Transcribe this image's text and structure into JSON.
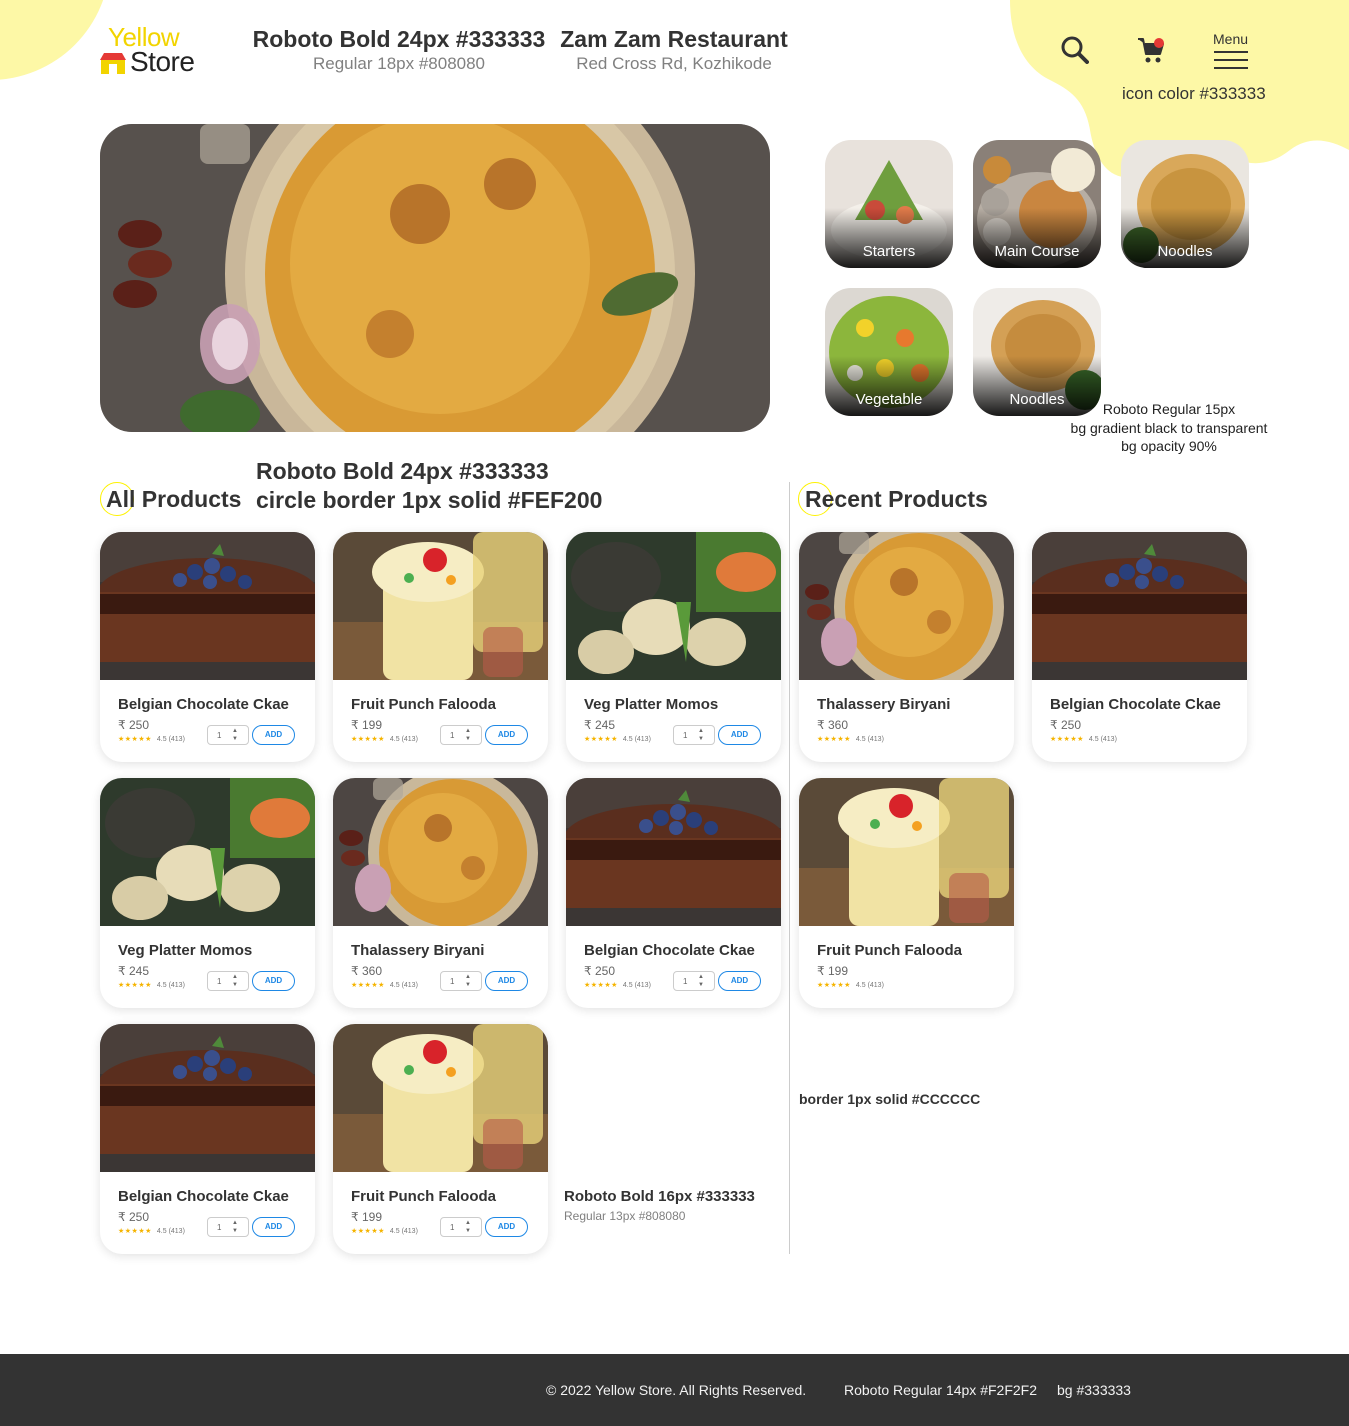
{
  "brand": {
    "logo_word1": "Yellow",
    "logo_word2": "Store",
    "accent_color": "#FEF200",
    "blob_color": "#FDF8A6"
  },
  "header": {
    "spec_title": "Roboto Bold 24px #333333",
    "spec_subtitle": "Regular 18px #808080",
    "restaurant_name": "Zam Zam Restaurant",
    "restaurant_address": "Red Cross Rd, Kozhikode",
    "menu_label": "Menu",
    "icon_note": "icon color #333333",
    "icons": [
      "search-icon",
      "cart-icon",
      "menu-icon"
    ]
  },
  "categories": {
    "items": [
      {
        "label": "Starters"
      },
      {
        "label": "Main Course"
      },
      {
        "label": "Noodles"
      },
      {
        "label": "Vegetable"
      },
      {
        "label": "Noodles"
      }
    ],
    "note_line1": "Roboto Regular 15px",
    "note_line2": "bg gradient black to transparent",
    "note_line3": "bg opacity 90%"
  },
  "sections": {
    "all_products": "All Products",
    "recent_products": "Recent Products",
    "annotation_line1": "Roboto Bold 24px #333333",
    "annotation_line2": "circle border 1px solid #FEF200"
  },
  "currency": "₹",
  "all_products": [
    {
      "name": "Belgian Chocolate Ckae",
      "price": "₹ 250",
      "stars": "★★★★★",
      "rating": "4.5 (413)",
      "qty": "1",
      "add": "ADD",
      "image": "cake"
    },
    {
      "name": "Fruit Punch Falooda",
      "price": "₹ 199",
      "stars": "★★★★★",
      "rating": "4.5 (413)",
      "qty": "1",
      "add": "ADD",
      "image": "falooda"
    },
    {
      "name": "Veg Platter Momos",
      "price": "₹ 245",
      "stars": "★★★★★",
      "rating": "4.5 (413)",
      "qty": "1",
      "add": "ADD",
      "image": "momos"
    },
    {
      "name": "Veg Platter Momos",
      "price": "₹ 245",
      "stars": "★★★★★",
      "rating": "4.5 (413)",
      "qty": "1",
      "add": "ADD",
      "image": "momos"
    },
    {
      "name": "Thalassery Biryani",
      "price": "₹ 360",
      "stars": "★★★★★",
      "rating": "4.5 (413)",
      "qty": "1",
      "add": "ADD",
      "image": "biryani"
    },
    {
      "name": "Belgian Chocolate Ckae",
      "price": "₹ 250",
      "stars": "★★★★★",
      "rating": "4.5 (413)",
      "qty": "1",
      "add": "ADD",
      "image": "cake"
    },
    {
      "name": "Belgian Chocolate Ckae",
      "price": "₹ 250",
      "stars": "★★★★★",
      "rating": "4.5 (413)",
      "qty": "1",
      "add": "ADD",
      "image": "cake"
    },
    {
      "name": "Fruit Punch Falooda",
      "price": "₹ 199",
      "stars": "★★★★★",
      "rating": "4.5 (413)",
      "qty": "1",
      "add": "ADD",
      "image": "falooda"
    }
  ],
  "recent_products": [
    {
      "name": "Thalassery Biryani",
      "price": "₹ 360",
      "stars": "★★★★★",
      "rating": "4.5 (413)",
      "image": "biryani"
    },
    {
      "name": "Belgian Chocolate Ckae",
      "price": "₹ 250",
      "stars": "★★★★★",
      "rating": "4.5 (413)",
      "image": "cake"
    },
    {
      "name": "Fruit Punch Falooda",
      "price": "₹ 199",
      "stars": "★★★★★",
      "rating": "4.5 (413)",
      "image": "falooda"
    }
  ],
  "annotations": {
    "card_title_spec": "Roboto Bold 16px #333333",
    "card_sub_spec": "Regular 13px #808080",
    "border_spec": "border 1px solid #CCCCCC"
  },
  "footer": {
    "copyright": "© 2022 Yellow Store. All Rights Reserved.",
    "font_spec": "Roboto Regular 14px #F2F2F2",
    "bg_spec": "bg #333333"
  }
}
